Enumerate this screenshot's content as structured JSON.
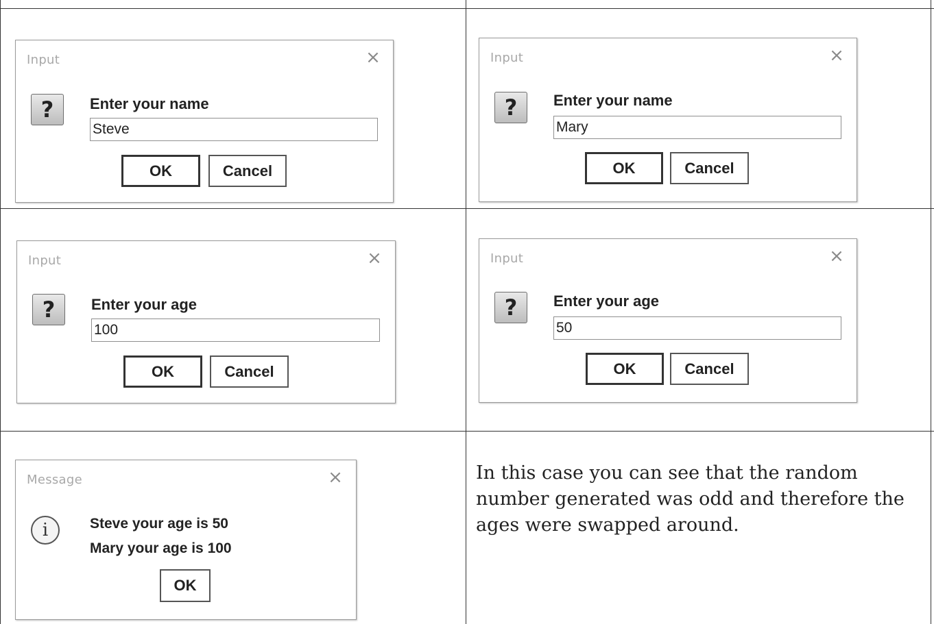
{
  "dialogs": {
    "name_steve": {
      "title": "Input",
      "close_glyph": "×",
      "icon": "question-icon",
      "prompt": "Enter your name",
      "value": "Steve",
      "ok_label": "OK",
      "cancel_label": "Cancel"
    },
    "name_mary": {
      "title": "Input",
      "close_glyph": "×",
      "icon": "question-icon",
      "prompt": "Enter your name",
      "value": "Mary",
      "ok_label": "OK",
      "cancel_label": "Cancel"
    },
    "age_steve": {
      "title": "Input",
      "close_glyph": "×",
      "icon": "question-icon",
      "prompt": "Enter your age",
      "value": "100",
      "ok_label": "OK",
      "cancel_label": "Cancel"
    },
    "age_mary": {
      "title": "Input",
      "close_glyph": "×",
      "icon": "question-icon",
      "prompt": "Enter your age",
      "value": "50",
      "ok_label": "OK",
      "cancel_label": "Cancel"
    },
    "message": {
      "title": "Message",
      "close_glyph": "×",
      "icon": "info-icon",
      "line1": "Steve your age is 50",
      "line2": "Mary your age is 100",
      "ok_label": "OK"
    }
  },
  "icons": {
    "question_glyph": "?",
    "info_glyph": "i"
  },
  "explanation": "In this case you can see that the random number generated was odd and therefore the ages were swapped around."
}
